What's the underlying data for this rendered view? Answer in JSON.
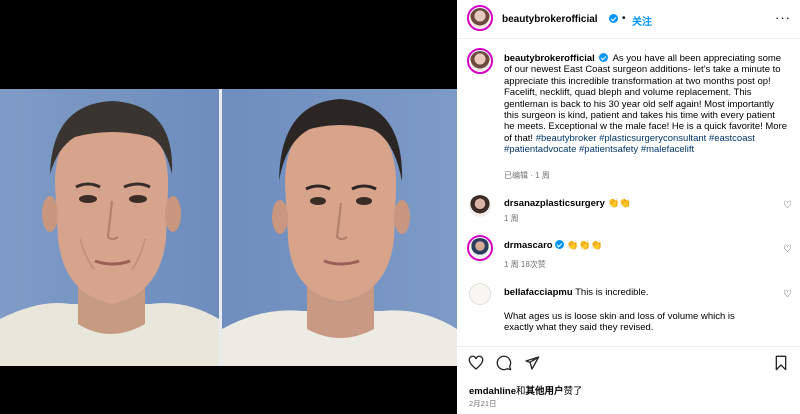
{
  "post": {
    "username": "beautybrokerofficial",
    "follow_label": "关注",
    "header_sep": "•",
    "more_icon": "more-horizontal-icon"
  },
  "caption": {
    "username": "beautybrokerofficial",
    "body": "As you have all been appreciating some of our newest East Coast surgeon additions- let’s take a minute to appreciate this incredible transformation at two months post op! Facelift, necklift, quad bleph and volume replacement. This gentleman is back to his 30 year old self again! Most importantly this surgeon is kind, patient and takes his time with every patient he meets. Exceptional w the male face! He is a quick favorite! More of that!",
    "tags": [
      "#beautybroker",
      "#plasticsurgeryconsultant",
      "#eastcoast",
      "#patientadvocate",
      "#patientsafety",
      "#malefacelift"
    ],
    "meta": "已编辑 · 1 周"
  },
  "comments": [
    {
      "username": "drsanazplasticsurgery",
      "text": "👏👏",
      "meta": "1 周"
    },
    {
      "username": "drmascaro",
      "text": "👏👏👏",
      "meta": "1 周    18次赞"
    },
    {
      "username": "bellafacciapmu",
      "text": "This is incredible.",
      "text2": "What ages us is loose skin and loss of volume which is exactly what they said they revised."
    }
  ],
  "likes": {
    "user": "emdahline",
    "connector": "和",
    "others": "其他用户",
    "suffix": "赞了"
  },
  "date": "2月21日",
  "colors": {
    "accent": "#0095f6",
    "hashtag": "#00376b",
    "secondary": "#737373",
    "photo_bg": "#7592c2"
  }
}
